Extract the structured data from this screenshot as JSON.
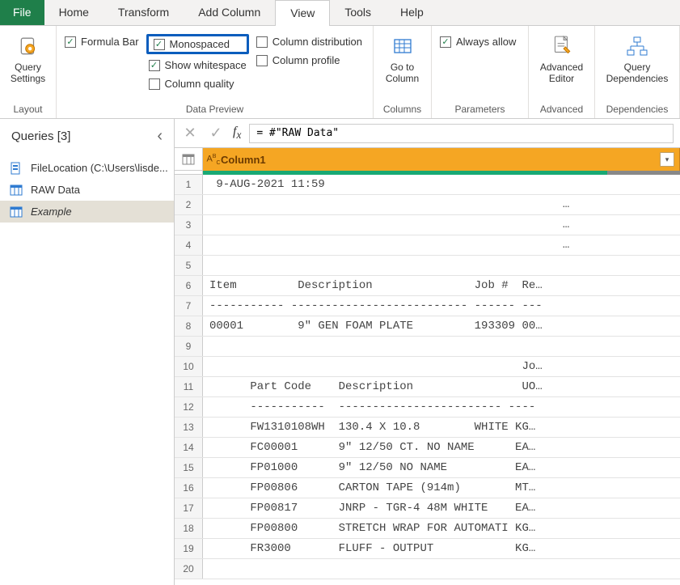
{
  "menu": {
    "tabs": [
      "File",
      "Home",
      "Transform",
      "Add Column",
      "View",
      "Tools",
      "Help"
    ],
    "active": "View"
  },
  "ribbon": {
    "query_settings": "Query Settings",
    "layout_group": "Layout",
    "formula_bar": "Formula Bar",
    "monospaced": "Monospaced",
    "show_whitespace": "Show whitespace",
    "column_quality": "Column quality",
    "column_distribution": "Column distribution",
    "column_profile": "Column profile",
    "data_preview_group": "Data Preview",
    "goto_column": "Go to Column",
    "columns_group": "Columns",
    "always_allow": "Always allow",
    "parameters_group": "Parameters",
    "advanced_editor": "Advanced Editor",
    "advanced_group": "Advanced",
    "query_dependencies": "Query Dependencies",
    "dependencies_group": "Dependencies"
  },
  "queries": {
    "title": "Queries [3]",
    "items": [
      {
        "label": "FileLocation (C:\\Users\\lisde...",
        "type": "param"
      },
      {
        "label": "RAW Data",
        "type": "table"
      },
      {
        "label": "Example",
        "type": "table",
        "selected": true
      }
    ]
  },
  "formula_bar": {
    "value": "= #\"RAW Data\""
  },
  "table": {
    "column": "Column1",
    "type_label": "A B C",
    "rows": [
      {
        "n": "1",
        "v": " 9-AUG-2021 11:59"
      },
      {
        "n": "2",
        "v": "                                                    …"
      },
      {
        "n": "3",
        "v": "                                                    …"
      },
      {
        "n": "4",
        "v": "                                                    …"
      },
      {
        "n": "5",
        "v": ""
      },
      {
        "n": "6",
        "v": "Item         Description               Job #  Re…"
      },
      {
        "n": "7",
        "v": "----------- -------------------------- ------ ---"
      },
      {
        "n": "8",
        "v": "00001        9\" GEN FOAM PLATE         193309 00…"
      },
      {
        "n": "9",
        "v": ""
      },
      {
        "n": "10",
        "v": "                                              Jo…"
      },
      {
        "n": "11",
        "v": "      Part Code    Description                UO…"
      },
      {
        "n": "12",
        "v": "      -----------  ------------------------ ----"
      },
      {
        "n": "13",
        "v": "      FW1310108WH  130.4 X 10.8        WHITE KG…"
      },
      {
        "n": "14",
        "v": "      FC00001      9\" 12/50 CT. NO NAME      EA…"
      },
      {
        "n": "15",
        "v": "      FP01000      9\" 12/50 NO NAME          EA…"
      },
      {
        "n": "16",
        "v": "      FP00806      CARTON TAPE (914m)        MT…"
      },
      {
        "n": "17",
        "v": "      FP00817      JNRP - TGR-4 48M WHITE    EA…"
      },
      {
        "n": "18",
        "v": "      FP00800      STRETCH WRAP FOR AUTOMATI KG…"
      },
      {
        "n": "19",
        "v": "      FR3000       FLUFF - OUTPUT            KG…"
      },
      {
        "n": "20",
        "v": ""
      }
    ]
  }
}
